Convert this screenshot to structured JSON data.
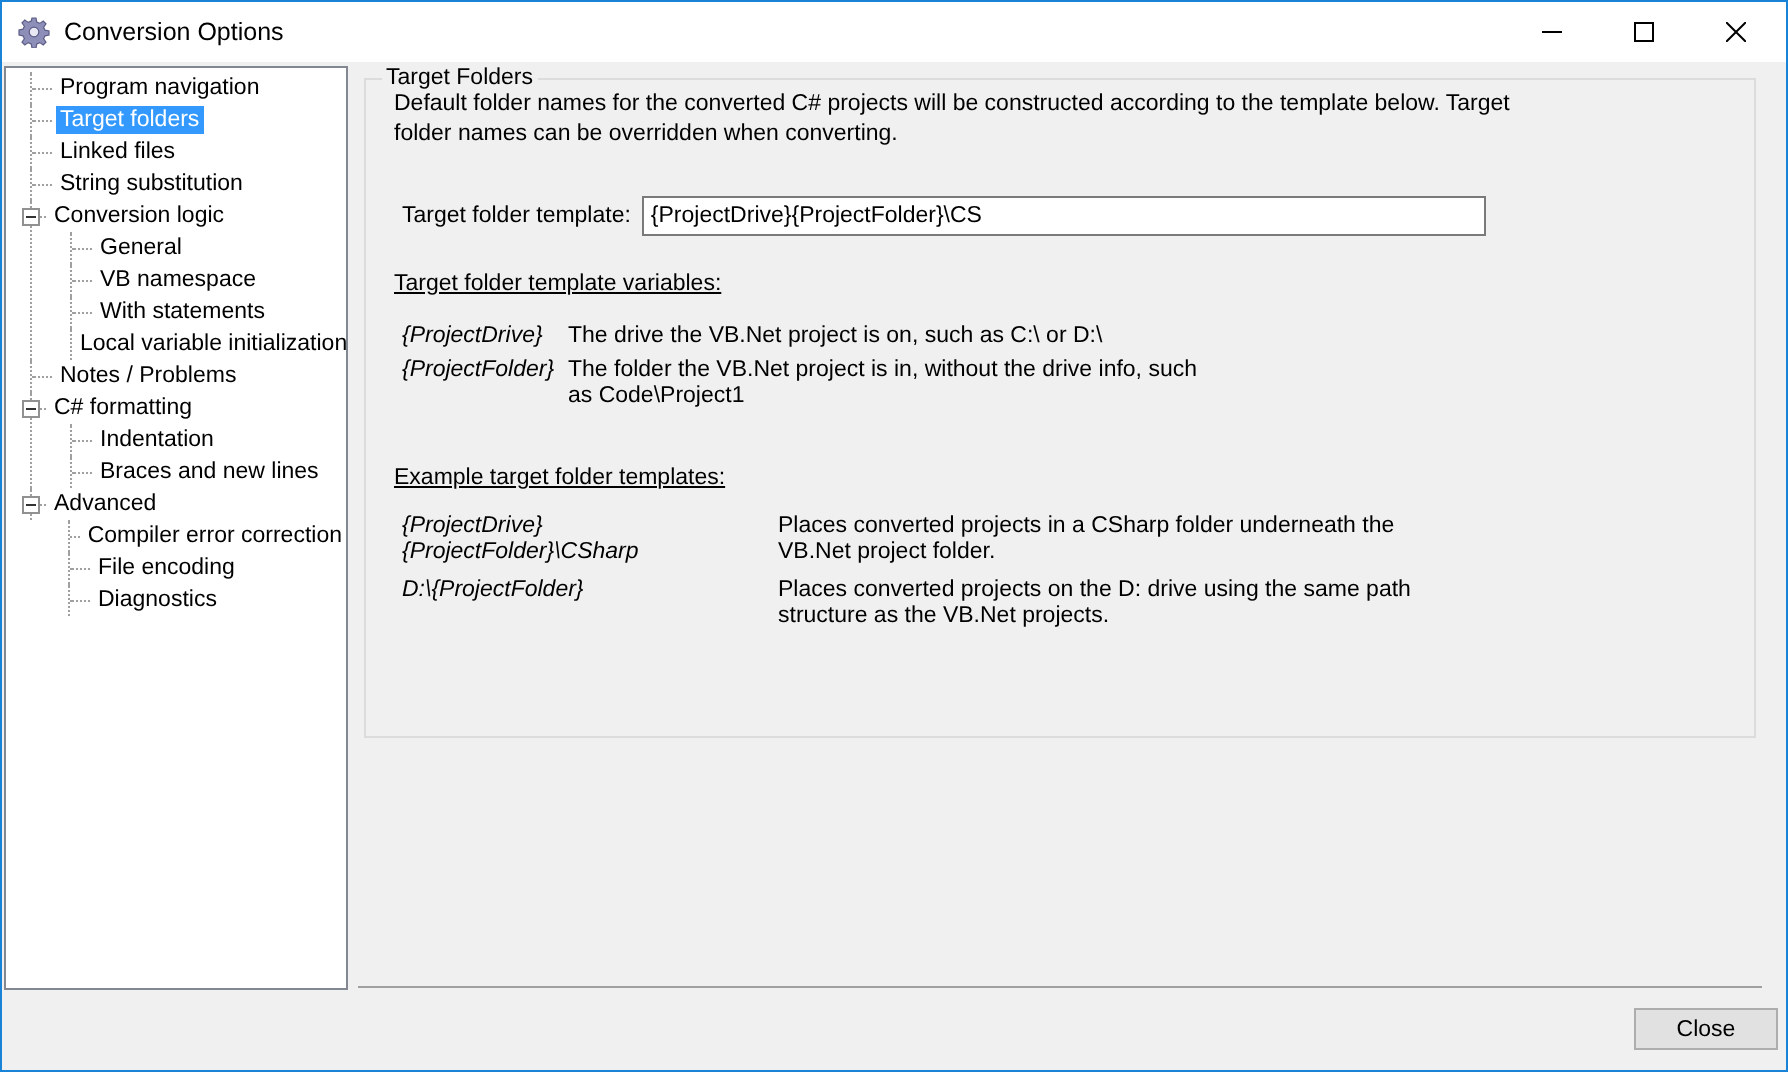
{
  "window": {
    "title": "Conversion Options"
  },
  "tree": [
    {
      "label": "Program navigation",
      "selected": false
    },
    {
      "label": "Target folders",
      "selected": true
    },
    {
      "label": "Linked files",
      "selected": false
    },
    {
      "label": "String substitution",
      "selected": false
    },
    {
      "label": "Conversion logic",
      "selected": false,
      "expanded": true,
      "children": [
        {
          "label": "General",
          "selected": false
        },
        {
          "label": "VB namespace",
          "selected": false
        },
        {
          "label": "With statements",
          "selected": false
        },
        {
          "label": "Local variable initialization",
          "selected": false
        }
      ]
    },
    {
      "label": "Notes / Problems",
      "selected": false
    },
    {
      "label": "C# formatting",
      "selected": false,
      "expanded": true,
      "children": [
        {
          "label": "Indentation",
          "selected": false
        },
        {
          "label": "Braces and new lines",
          "selected": false
        }
      ]
    },
    {
      "label": "Advanced",
      "selected": false,
      "expanded": true,
      "children": [
        {
          "label": "Compiler error correction",
          "selected": false
        },
        {
          "label": "File encoding",
          "selected": false
        },
        {
          "label": "Diagnostics",
          "selected": false
        }
      ]
    }
  ],
  "group": {
    "title": "Target Folders",
    "description": "Default folder names for the converted C# projects will be constructed according to the template below.  Target folder names can be overridden when converting.",
    "field": {
      "label": "Target folder template:",
      "value": "{ProjectDrive}{ProjectFolder}\\CS"
    },
    "variables_heading": "Target folder template variables:",
    "variables": [
      {
        "name": "{ProjectDrive}",
        "text": "The drive the VB.Net project is on, such as C:\\ or D:\\"
      },
      {
        "name": "{ProjectFolder}",
        "text": "The folder the VB.Net project is in, without the drive info, such as Code\\Project1"
      }
    ],
    "examples_heading": "Example target folder templates:",
    "examples": [
      {
        "name": "{ProjectDrive}{ProjectFolder}\\CSharp",
        "text": "Places converted projects in a CSharp folder underneath the VB.Net project folder."
      },
      {
        "name": "D:\\{ProjectFolder}",
        "text": "Places converted projects on the D: drive using the same path structure as the VB.Net projects."
      }
    ]
  },
  "buttons": [
    "Close"
  ]
}
